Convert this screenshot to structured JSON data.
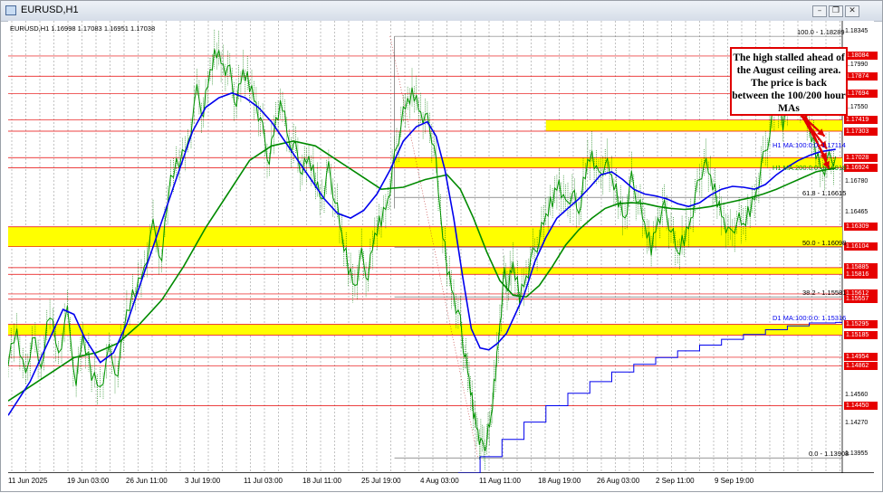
{
  "window": {
    "title": "EURUSD,H1",
    "buttons": {
      "close": "✕",
      "restore": "❐",
      "minimize": "–"
    }
  },
  "ohlc_header": "EURUSD,H1  1.16998 1.17083 1.16951 1.17038",
  "callout_text": "The high stalled ahead of the August ceiling area. The price is back between the 100/200 hour MAs",
  "price_axis": {
    "ticks": [
      {
        "label": "1.18345",
        "value": 1.18345
      },
      {
        "label": "1.17990",
        "value": 1.1799
      },
      {
        "label": "1.17550",
        "value": 1.1755
      },
      {
        "label": "1.16780",
        "value": 1.1678
      },
      {
        "label": "1.16465",
        "value": 1.16465
      },
      {
        "label": "1.14560",
        "value": 1.1456
      },
      {
        "label": "1.14270",
        "value": 1.1427
      },
      {
        "label": "1.13955",
        "value": 1.13955
      }
    ],
    "red_labels": [
      {
        "label": "1.18084",
        "value": 1.18084
      },
      {
        "label": "1.17874",
        "value": 1.17874
      },
      {
        "label": "1.17694",
        "value": 1.17694
      },
      {
        "label": "1.17419",
        "value": 1.17419
      },
      {
        "label": "1.17303",
        "value": 1.17303
      },
      {
        "label": "1.17028",
        "value": 1.17028
      },
      {
        "label": "1.16924",
        "value": 1.16924
      },
      {
        "label": "1.16309",
        "value": 1.16309
      },
      {
        "label": "1.16104",
        "value": 1.16104
      },
      {
        "label": "1.15885",
        "value": 1.15885
      },
      {
        "label": "1.15816",
        "value": 1.15816
      },
      {
        "label": "1.15612",
        "value": 1.15612
      },
      {
        "label": "1.15557",
        "value": 1.15557
      },
      {
        "label": "1.15295",
        "value": 1.15295
      },
      {
        "label": "1.15185",
        "value": 1.15185
      },
      {
        "label": "1.14954",
        "value": 1.14954
      },
      {
        "label": "1.14862",
        "value": 1.14862
      },
      {
        "label": "1.14450",
        "value": 1.1445
      }
    ]
  },
  "time_axis": [
    "11 Jun 2025",
    "19 Jun 03:00",
    "26 Jun 11:00",
    "3 Jul 19:00",
    "11 Jul 03:00",
    "18 Jul 11:00",
    "25 Jul 19:00",
    "4 Aug 03:00",
    "11 Aug 11:00",
    "18 Aug 19:00",
    "26 Aug 03:00",
    "2 Sep 11:00",
    "9 Sep 19:00"
  ],
  "fib_levels": [
    {
      "label": "100.0 - 1.18289",
      "value": 1.18289
    },
    {
      "label": "61.8 - 1.16615",
      "value": 1.16615
    },
    {
      "label": "50.0 - 1.16098",
      "value": 1.16098
    },
    {
      "label": "38.2 - 1.15581",
      "value": 1.15581
    },
    {
      "label": "0.0 - 1.13908",
      "value": 1.13908
    }
  ],
  "ma_labels": {
    "h1_ma100": "H1 MA:100:0:0: 1.17114",
    "h1_ma200": "H1 MA:200:0:0: 1.16918",
    "d1_ma100": "D1 MA:100:0:0: 1.15316"
  },
  "colors": {
    "candle": "#009900",
    "ma100": "#0000ee",
    "ma200": "#008a00",
    "zone": "#ffff00",
    "red": "#e60000",
    "callout_border": "#e00000"
  },
  "chart_data": {
    "type": "line",
    "symbol": "EURUSD",
    "timeframe": "H1",
    "y_range": [
      1.1375,
      1.1845
    ],
    "x": [
      "11 Jun 2025",
      "19 Jun 03:00",
      "26 Jun 11:00",
      "3 Jul 19:00",
      "11 Jul 03:00",
      "18 Jul 11:00",
      "25 Jul 19:00",
      "4 Aug 03:00",
      "11 Aug 11:00",
      "18 Aug 19:00",
      "26 Aug 03:00",
      "2 Sep 11:00",
      "9 Sep 19:00"
    ],
    "price_path": [
      [
        0,
        1.1495
      ],
      [
        4,
        1.1525
      ],
      [
        8,
        1.147
      ],
      [
        11,
        1.152
      ],
      [
        15,
        1.148
      ],
      [
        19,
        1.1545
      ],
      [
        23,
        1.15
      ],
      [
        27,
        1.154
      ],
      [
        31,
        1.147
      ],
      [
        34,
        1.1515
      ],
      [
        38,
        1.148
      ],
      [
        42,
        1.1465
      ],
      [
        46,
        1.15
      ],
      [
        50,
        1.148
      ],
      [
        54,
        1.154
      ],
      [
        58,
        1.1565
      ],
      [
        62,
        1.159
      ],
      [
        66,
        1.163
      ],
      [
        70,
        1.16
      ],
      [
        74,
        1.168
      ],
      [
        78,
        1.17
      ],
      [
        82,
        1.172
      ],
      [
        86,
        1.177
      ],
      [
        89,
        1.175
      ],
      [
        92,
        1.179
      ],
      [
        95,
        1.1815
      ],
      [
        98,
        1.18
      ],
      [
        101,
        1.179
      ],
      [
        104,
        1.176
      ],
      [
        107,
        1.179
      ],
      [
        110,
        1.178
      ],
      [
        113,
        1.176
      ],
      [
        116,
        1.173
      ],
      [
        119,
        1.17
      ],
      [
        122,
        1.174
      ],
      [
        125,
        1.176
      ],
      [
        128,
        1.172
      ],
      [
        131,
        1.171
      ],
      [
        134,
        1.169
      ],
      [
        137,
        1.17
      ],
      [
        140,
        1.168
      ],
      [
        143,
        1.166
      ],
      [
        146,
        1.169
      ],
      [
        149,
        1.166
      ],
      [
        152,
        1.162
      ],
      [
        155,
        1.159
      ],
      [
        158,
        1.157
      ],
      [
        161,
        1.16
      ],
      [
        164,
        1.158
      ],
      [
        167,
        1.162
      ],
      [
        170,
        1.164
      ],
      [
        173,
        1.166
      ],
      [
        176,
        1.17
      ],
      [
        179,
        1.174
      ],
      [
        182,
        1.176
      ],
      [
        185,
        1.177
      ],
      [
        188,
        1.175
      ],
      [
        191,
        1.174
      ],
      [
        194,
        1.172
      ],
      [
        197,
        1.164
      ],
      [
        200,
        1.159
      ],
      [
        203,
        1.156
      ],
      [
        206,
        1.153
      ],
      [
        208,
        1.15
      ],
      [
        210,
        1.147
      ],
      [
        212,
        1.144
      ],
      [
        214,
        1.142
      ],
      [
        216,
        1.14
      ],
      [
        218,
        1.141
      ],
      [
        220,
        1.143
      ],
      [
        222,
        1.148
      ],
      [
        224,
        1.153
      ],
      [
        226,
        1.158
      ],
      [
        228,
        1.157
      ],
      [
        230,
        1.159
      ],
      [
        233,
        1.156
      ],
      [
        236,
        1.158
      ],
      [
        239,
        1.16
      ],
      [
        242,
        1.162
      ],
      [
        245,
        1.164
      ],
      [
        248,
        1.166
      ],
      [
        251,
        1.168
      ],
      [
        254,
        1.165
      ],
      [
        257,
        1.167
      ],
      [
        260,
        1.164
      ],
      [
        263,
        1.169
      ],
      [
        266,
        1.171
      ],
      [
        269,
        1.168
      ],
      [
        272,
        1.17
      ],
      [
        275,
        1.168
      ],
      [
        278,
        1.166
      ],
      [
        281,
        1.164
      ],
      [
        284,
        1.168
      ],
      [
        287,
        1.166
      ],
      [
        290,
        1.163
      ],
      [
        293,
        1.161
      ],
      [
        296,
        1.164
      ],
      [
        299,
        1.165
      ],
      [
        302,
        1.163
      ],
      [
        305,
        1.16
      ],
      [
        308,
        1.162
      ],
      [
        311,
        1.164
      ],
      [
        314,
        1.167
      ],
      [
        317,
        1.17
      ],
      [
        320,
        1.168
      ],
      [
        323,
        1.166
      ],
      [
        326,
        1.164
      ],
      [
        329,
        1.162
      ],
      [
        332,
        1.164
      ],
      [
        335,
        1.163
      ],
      [
        338,
        1.165
      ],
      [
        341,
        1.167
      ],
      [
        344,
        1.17
      ],
      [
        347,
        1.173
      ],
      [
        350,
        1.176
      ],
      [
        353,
        1.174
      ],
      [
        356,
        1.177
      ],
      [
        359,
        1.1785
      ],
      [
        362,
        1.176
      ],
      [
        365,
        1.173
      ],
      [
        368,
        1.171
      ],
      [
        371,
        1.169
      ],
      [
        374,
        1.17
      ],
      [
        377,
        1.1704
      ]
    ],
    "ma100_path": [
      [
        0,
        1.1435
      ],
      [
        10,
        1.147
      ],
      [
        20,
        1.152
      ],
      [
        25,
        1.1545
      ],
      [
        30,
        1.154
      ],
      [
        35,
        1.1515
      ],
      [
        42,
        1.149
      ],
      [
        48,
        1.15
      ],
      [
        54,
        1.153
      ],
      [
        60,
        1.157
      ],
      [
        66,
        1.161
      ],
      [
        72,
        1.165
      ],
      [
        78,
        1.169
      ],
      [
        84,
        1.173
      ],
      [
        90,
        1.1755
      ],
      [
        96,
        1.1765
      ],
      [
        102,
        1.177
      ],
      [
        108,
        1.1765
      ],
      [
        114,
        1.1755
      ],
      [
        120,
        1.174
      ],
      [
        126,
        1.172
      ],
      [
        132,
        1.17
      ],
      [
        138,
        1.168
      ],
      [
        144,
        1.166
      ],
      [
        150,
        1.1645
      ],
      [
        156,
        1.164
      ],
      [
        162,
        1.1648
      ],
      [
        168,
        1.1665
      ],
      [
        174,
        1.169
      ],
      [
        180,
        1.172
      ],
      [
        186,
        1.1735
      ],
      [
        191,
        1.174
      ],
      [
        195,
        1.1725
      ],
      [
        199,
        1.169
      ],
      [
        203,
        1.164
      ],
      [
        207,
        1.158
      ],
      [
        211,
        1.1525
      ],
      [
        215,
        1.1505
      ],
      [
        219,
        1.1503
      ],
      [
        223,
        1.151
      ],
      [
        227,
        1.152
      ],
      [
        231,
        1.154
      ],
      [
        235,
        1.156
      ],
      [
        240,
        1.1595
      ],
      [
        245,
        1.162
      ],
      [
        250,
        1.164
      ],
      [
        255,
        1.165
      ],
      [
        260,
        1.166
      ],
      [
        265,
        1.1672
      ],
      [
        270,
        1.1685
      ],
      [
        275,
        1.1688
      ],
      [
        280,
        1.168
      ],
      [
        285,
        1.167
      ],
      [
        290,
        1.1665
      ],
      [
        295,
        1.1663
      ],
      [
        300,
        1.166
      ],
      [
        305,
        1.1655
      ],
      [
        310,
        1.1652
      ],
      [
        315,
        1.1656
      ],
      [
        320,
        1.1664
      ],
      [
        325,
        1.167
      ],
      [
        330,
        1.1673
      ],
      [
        335,
        1.1672
      ],
      [
        340,
        1.167
      ],
      [
        345,
        1.1675
      ],
      [
        350,
        1.1685
      ],
      [
        355,
        1.1693
      ],
      [
        360,
        1.17
      ],
      [
        365,
        1.1705
      ],
      [
        370,
        1.1709
      ],
      [
        377,
        1.17114
      ]
    ],
    "ma200_path": [
      [
        0,
        1.145
      ],
      [
        10,
        1.1465
      ],
      [
        20,
        1.148
      ],
      [
        30,
        1.1495
      ],
      [
        40,
        1.15
      ],
      [
        50,
        1.151
      ],
      [
        60,
        1.153
      ],
      [
        70,
        1.1555
      ],
      [
        80,
        1.159
      ],
      [
        90,
        1.163
      ],
      [
        100,
        1.1665
      ],
      [
        110,
        1.17
      ],
      [
        120,
        1.1715
      ],
      [
        130,
        1.172
      ],
      [
        140,
        1.1715
      ],
      [
        150,
        1.17
      ],
      [
        160,
        1.1685
      ],
      [
        170,
        1.167
      ],
      [
        180,
        1.1672
      ],
      [
        190,
        1.168
      ],
      [
        200,
        1.1685
      ],
      [
        206,
        1.167
      ],
      [
        212,
        1.164
      ],
      [
        218,
        1.1605
      ],
      [
        224,
        1.1575
      ],
      [
        230,
        1.156
      ],
      [
        236,
        1.1558
      ],
      [
        242,
        1.157
      ],
      [
        248,
        1.159
      ],
      [
        254,
        1.1612
      ],
      [
        260,
        1.1628
      ],
      [
        266,
        1.164
      ],
      [
        272,
        1.165
      ],
      [
        278,
        1.1655
      ],
      [
        284,
        1.1656
      ],
      [
        290,
        1.1655
      ],
      [
        296,
        1.1652
      ],
      [
        302,
        1.165
      ],
      [
        308,
        1.1649
      ],
      [
        314,
        1.165
      ],
      [
        320,
        1.1652
      ],
      [
        326,
        1.1655
      ],
      [
        332,
        1.1658
      ],
      [
        338,
        1.1661
      ],
      [
        344,
        1.1665
      ],
      [
        350,
        1.167
      ],
      [
        356,
        1.1676
      ],
      [
        362,
        1.1682
      ],
      [
        368,
        1.1688
      ],
      [
        374,
        1.1691
      ],
      [
        377,
        1.16918
      ]
    ],
    "d1_ma100_path": [
      [
        205,
        1.1375
      ],
      [
        215,
        1.1392
      ],
      [
        225,
        1.141
      ],
      [
        235,
        1.1428
      ],
      [
        245,
        1.1445
      ],
      [
        255,
        1.1458
      ],
      [
        265,
        1.147
      ],
      [
        275,
        1.148
      ],
      [
        285,
        1.1488
      ],
      [
        295,
        1.1495
      ],
      [
        305,
        1.1502
      ],
      [
        315,
        1.1508
      ],
      [
        325,
        1.1514
      ],
      [
        335,
        1.1519
      ],
      [
        345,
        1.1524
      ],
      [
        355,
        1.1528
      ],
      [
        365,
        1.1531
      ],
      [
        377,
        1.15316
      ]
    ],
    "zones": [
      {
        "from": 1.17303,
        "to": 1.17419,
        "start": 245
      },
      {
        "from": 1.16924,
        "to": 1.17028,
        "start": 176
      },
      {
        "from": 1.16104,
        "to": 1.16309,
        "start": 0
      },
      {
        "from": 1.15816,
        "to": 1.15885,
        "start": 206
      },
      {
        "from": 1.15185,
        "to": 1.15295,
        "start": 0
      }
    ],
    "horizontal_lines": [
      1.18084,
      1.17874,
      1.17694,
      1.15612,
      1.15557,
      1.14954,
      1.14862,
      1.1445
    ],
    "annotation": "The high stalled ahead of the August ceiling area. The price is back between the 100/200 hour MAs"
  }
}
